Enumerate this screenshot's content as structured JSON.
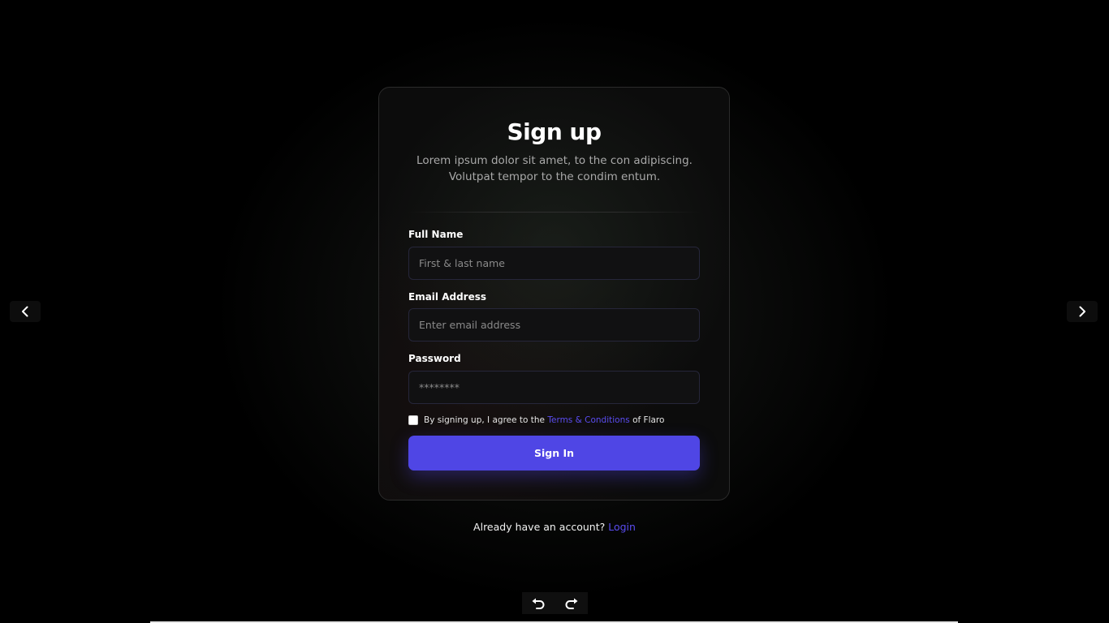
{
  "signup": {
    "title": "Sign up",
    "subtitle_line1": "Lorem ipsum dolor sit amet, to the con adipiscing.",
    "subtitle_line2": "Volutpat tempor to the condim entum.",
    "full_name": {
      "label": "Full Name",
      "placeholder": "First & last name",
      "value": ""
    },
    "email": {
      "label": "Email Address",
      "placeholder": "Enter email address",
      "value": ""
    },
    "password": {
      "label": "Password",
      "placeholder": "********",
      "value": ""
    },
    "agree": {
      "prefix": "By signing up, I agree to the ",
      "link": "Terms & Conditions",
      "suffix": " of Flaro",
      "checked": false
    },
    "submit_label": "Sign In"
  },
  "footer": {
    "prompt": "Already have an account? ",
    "login_link": "Login"
  },
  "navigation": {
    "prev_icon": "chevron-left-icon",
    "next_icon": "chevron-right-icon"
  },
  "toolbar": {
    "undo_icon": "undo-icon",
    "redo_icon": "redo-icon"
  },
  "colors": {
    "accent": "#4f46e5",
    "link": "#5a4cf0",
    "background": "#000000"
  }
}
